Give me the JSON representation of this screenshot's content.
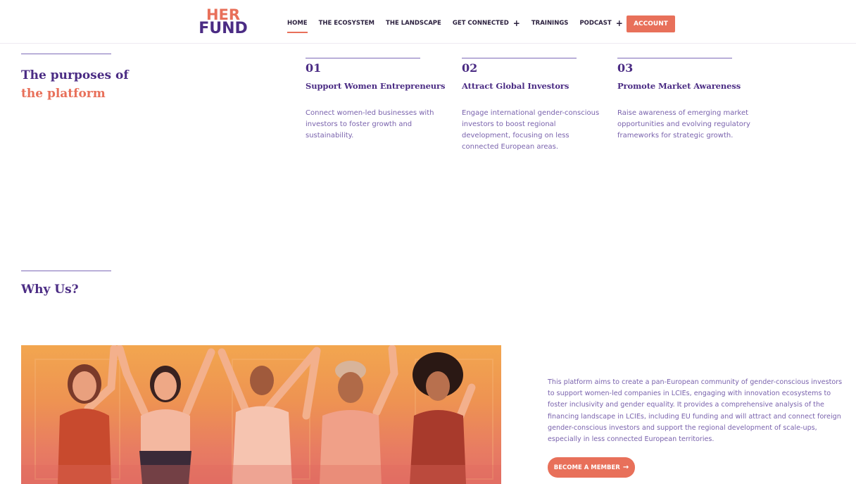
{
  "header": {
    "logo_line1": "HER",
    "logo_line2": "FUND",
    "nav": [
      {
        "label": "HOME",
        "active": true
      },
      {
        "label": "THE ECOSYSTEM"
      },
      {
        "label": "THE LANDSCAPE"
      },
      {
        "label": "GET CONNECTED",
        "plus": "+"
      },
      {
        "label": "TRAININGS"
      },
      {
        "label": "PODCAST",
        "plus": "+"
      }
    ],
    "account_label": "ACCOUNT"
  },
  "purposes": {
    "title_line1": "The purposes of",
    "title_line2": "the platform",
    "cards": [
      {
        "number": "01",
        "title": "Support Women Entrepreneurs",
        "description": "Connect women-led businesses with investors to foster growth and sustainability."
      },
      {
        "number": "02",
        "title": "Attract Global Investors",
        "description": "Engage international gender-conscious investors to boost regional development, focusing on less connected European areas."
      },
      {
        "number": "03",
        "title": "Promote Market Awareness",
        "description": "Raise awareness of emerging market opportunities and evolving regulatory frameworks for strategic growth."
      }
    ]
  },
  "why_us": {
    "title": "Why Us?",
    "text": "This platform aims to create a pan-European community of gender-conscious investors to support women-led companies in LCIEs, engaging with innovation ecosystems to foster inclusivity and gender equality. It provides a comprehensive analysis of the financing landscape in LCIEs, including EU funding and will attract and connect foreign gender-conscious investors and support the regional development of scale-ups, especially in less connected European territories.",
    "button_label": "BECOME A MEMBER",
    "button_arrow": "→"
  },
  "colors": {
    "accent": "#e8705a",
    "brand_purple": "#4b2c84",
    "text_purple": "#7a63ad"
  }
}
